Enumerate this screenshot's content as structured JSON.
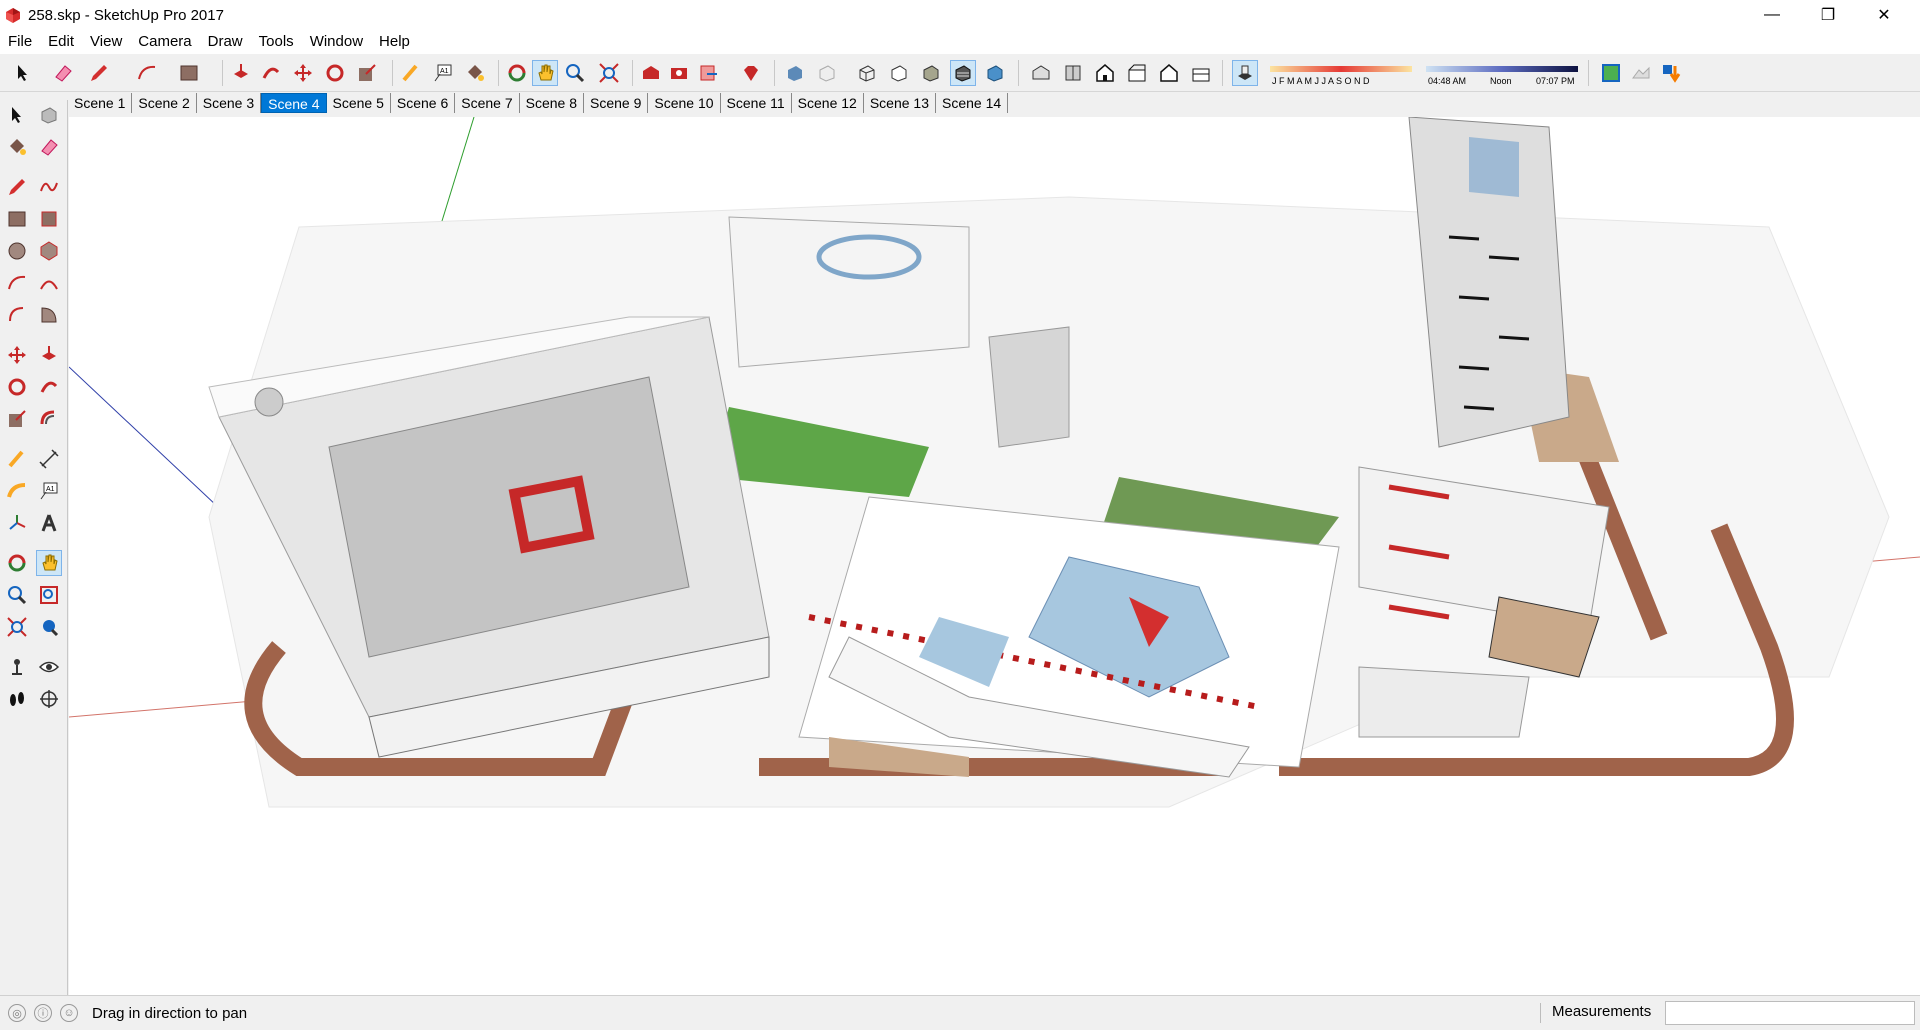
{
  "window": {
    "title": "258.skp - SketchUp Pro 2017",
    "minimize": "—",
    "maximize": "❐",
    "close": "✕"
  },
  "menu": [
    "File",
    "Edit",
    "View",
    "Camera",
    "Draw",
    "Tools",
    "Window",
    "Help"
  ],
  "shadow": {
    "months": "J F M A M J J A S O N D",
    "time_start": "04:48 AM",
    "time_mid": "Noon",
    "time_end": "07:07 PM"
  },
  "scenes": {
    "tabs": [
      "Scene 1",
      "Scene 2",
      "Scene 3",
      "Scene 4",
      "Scene 5",
      "Scene 6",
      "Scene 7",
      "Scene 8",
      "Scene 9",
      "Scene 10",
      "Scene 11",
      "Scene 12",
      "Scene 13",
      "Scene 14"
    ],
    "active": "Scene 4"
  },
  "status": {
    "hint": "Drag in direction to pan",
    "measurements_label": "Measurements",
    "measurements_value": ""
  },
  "colors": {
    "accent": "#0078d7",
    "axis_red": "#c0392b",
    "axis_green": "#2e9e2e",
    "axis_blue": "#2f3fa8"
  }
}
